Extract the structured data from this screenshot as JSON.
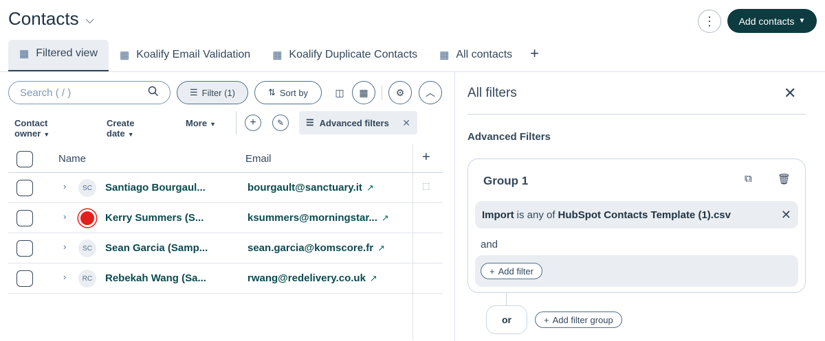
{
  "header": {
    "title": "Contacts",
    "add_contacts_label": "Add contacts"
  },
  "tabs": [
    {
      "label": "Filtered view",
      "active": true
    },
    {
      "label": "Koalify Email Validation",
      "active": false
    },
    {
      "label": "Koalify Duplicate Contacts",
      "active": false
    },
    {
      "label": "All contacts",
      "active": false
    }
  ],
  "toolbar": {
    "search_placeholder": "Search ( / )",
    "filter_label": "Filter (1)",
    "sort_label": "Sort by"
  },
  "filters": {
    "contact_owner": "Contact owner",
    "create_date": "Create date",
    "more": "More",
    "advanced_filters": "Advanced filters"
  },
  "table": {
    "columns": [
      "Name",
      "Email"
    ],
    "rows": [
      {
        "initials": "SC",
        "name": "Santiago Bourgaul...",
        "email": "bourgault@sanctuary.it",
        "avatar": "initials"
      },
      {
        "initials": "",
        "name": "Kerry Summers (S...",
        "email": "ksummers@morningstar...",
        "avatar": "red"
      },
      {
        "initials": "SC",
        "name": "Sean Garcia (Samp...",
        "email": "sean.garcia@komscore.fr",
        "avatar": "initials"
      },
      {
        "initials": "RC",
        "name": "Rebekah Wang (Sa...",
        "email": "rwang@redelivery.co.uk",
        "avatar": "initials"
      }
    ]
  },
  "panel": {
    "title": "All filters",
    "section_title": "Advanced Filters",
    "group_title": "Group 1",
    "criterion": {
      "property": "Import",
      "operator": "is any of",
      "value": "HubSpot Contacts Template (1).csv"
    },
    "and_label": "and",
    "add_filter_label": "Add filter",
    "or_label": "or",
    "add_filter_group_label": "Add filter group"
  },
  "colors": {
    "primary_dark": "#0d3b3f",
    "link": "#0b4a4f",
    "text": "#33475b",
    "chip_bg": "#eaeef2"
  }
}
